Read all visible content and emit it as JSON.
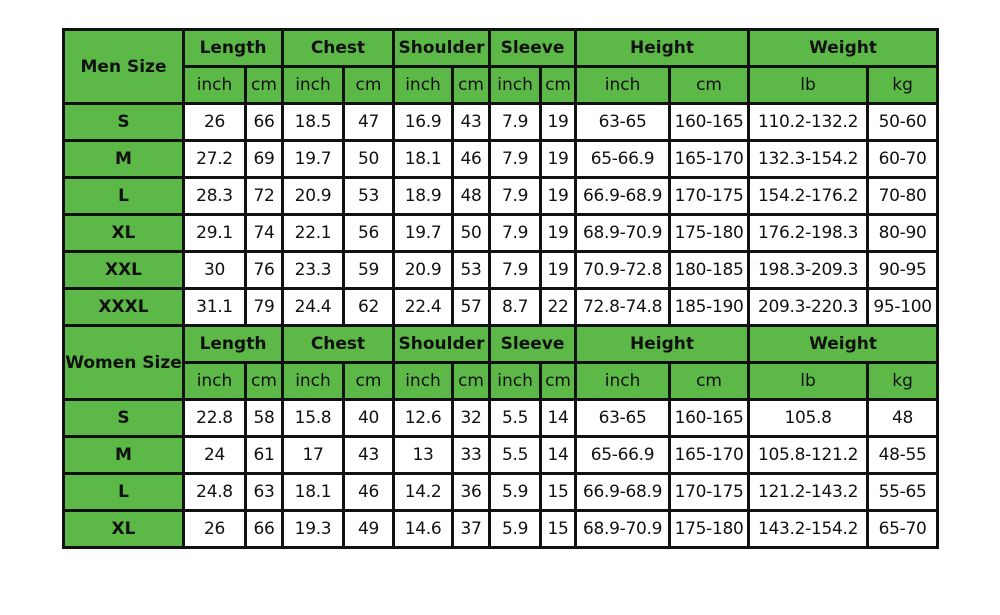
{
  "colors": {
    "header_bg": "#5cb947",
    "cell_bg": "#ffffff",
    "border": "#111111"
  },
  "sections": [
    {
      "size_label": "Men Size",
      "groups": [
        "Length",
        "Chest",
        "Shoulder",
        "Sleeve",
        "Height",
        "Weight"
      ],
      "units": [
        "inch",
        "cm",
        "inch",
        "cm",
        "inch",
        "cm",
        "inch",
        "cm",
        "inch",
        "cm",
        "lb",
        "kg"
      ],
      "rows": [
        {
          "size": "S",
          "values": [
            "26",
            "66",
            "18.5",
            "47",
            "16.9",
            "43",
            "7.9",
            "19",
            "63-65",
            "160-165",
            "110.2-132.2",
            "50-60"
          ]
        },
        {
          "size": "M",
          "values": [
            "27.2",
            "69",
            "19.7",
            "50",
            "18.1",
            "46",
            "7.9",
            "19",
            "65-66.9",
            "165-170",
            "132.3-154.2",
            "60-70"
          ]
        },
        {
          "size": "L",
          "values": [
            "28.3",
            "72",
            "20.9",
            "53",
            "18.9",
            "48",
            "7.9",
            "19",
            "66.9-68.9",
            "170-175",
            "154.2-176.2",
            "70-80"
          ]
        },
        {
          "size": "XL",
          "values": [
            "29.1",
            "74",
            "22.1",
            "56",
            "19.7",
            "50",
            "7.9",
            "19",
            "68.9-70.9",
            "175-180",
            "176.2-198.3",
            "80-90"
          ]
        },
        {
          "size": "XXL",
          "values": [
            "30",
            "76",
            "23.3",
            "59",
            "20.9",
            "53",
            "7.9",
            "19",
            "70.9-72.8",
            "180-185",
            "198.3-209.3",
            "90-95"
          ]
        },
        {
          "size": "XXXL",
          "values": [
            "31.1",
            "79",
            "24.4",
            "62",
            "22.4",
            "57",
            "8.7",
            "22",
            "72.8-74.8",
            "185-190",
            "209.3-220.3",
            "95-100"
          ]
        }
      ]
    },
    {
      "size_label": "Women Size",
      "groups": [
        "Length",
        "Chest",
        "Shoulder",
        "Sleeve",
        "Height",
        "Weight"
      ],
      "units": [
        "inch",
        "cm",
        "inch",
        "cm",
        "inch",
        "cm",
        "inch",
        "cm",
        "inch",
        "cm",
        "lb",
        "kg"
      ],
      "rows": [
        {
          "size": "S",
          "values": [
            "22.8",
            "58",
            "15.8",
            "40",
            "12.6",
            "32",
            "5.5",
            "14",
            "63-65",
            "160-165",
            "105.8",
            "48"
          ]
        },
        {
          "size": "M",
          "values": [
            "24",
            "61",
            "17",
            "43",
            "13",
            "33",
            "5.5",
            "14",
            "65-66.9",
            "165-170",
            "105.8-121.2",
            "48-55"
          ]
        },
        {
          "size": "L",
          "values": [
            "24.8",
            "63",
            "18.1",
            "46",
            "14.2",
            "36",
            "5.9",
            "15",
            "66.9-68.9",
            "170-175",
            "121.2-143.2",
            "55-65"
          ]
        },
        {
          "size": "XL",
          "values": [
            "26",
            "66",
            "19.3",
            "49",
            "14.6",
            "37",
            "5.9",
            "15",
            "68.9-70.9",
            "175-180",
            "143.2-154.2",
            "65-70"
          ]
        }
      ]
    }
  ]
}
